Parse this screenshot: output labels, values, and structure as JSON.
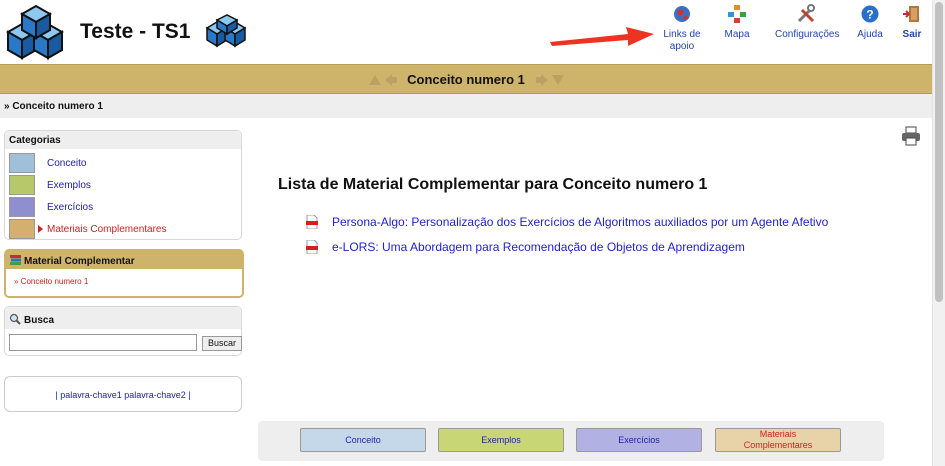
{
  "app": {
    "title": "Teste - TS1"
  },
  "nav": [
    {
      "label": "Links de apoio",
      "icon": "globe-icon"
    },
    {
      "label": "Mapa",
      "icon": "sitemap-icon"
    },
    {
      "label": "Configurações",
      "icon": "tools-icon"
    },
    {
      "label": "Ajuda",
      "icon": "help-icon"
    },
    {
      "label": "Sair",
      "icon": "exit-door-icon"
    }
  ],
  "concept_bar": {
    "title": "Conceito numero 1"
  },
  "breadcrumb": "» Conceito numero 1",
  "sidebar": {
    "categories": {
      "header": "Categorias",
      "items": [
        {
          "label": "Conceito",
          "icon": "book-icon",
          "color": "#9fc0d8"
        },
        {
          "label": "Exemplos",
          "icon": "notebook-icon",
          "color": "#b6c86a"
        },
        {
          "label": "Exercícios",
          "icon": "exercise-icon",
          "color": "#8f8fd0"
        },
        {
          "label": "Materiais Complementares",
          "icon": "books-stack-icon",
          "color": "#d4b070",
          "active": true
        }
      ]
    },
    "material": {
      "header": "Material Complementar",
      "link": "» Conceito numero 1"
    },
    "busca": {
      "header": "Busca",
      "input_value": "",
      "button": "Buscar"
    },
    "keywords": {
      "prefix": "| ",
      "items": [
        "palavra-chave1",
        "palavra-chave2"
      ],
      "suffix": " |"
    }
  },
  "main": {
    "title": "Lista de Material Complementar para Conceito numero 1",
    "materials": [
      "Persona-Algo: Personalização dos Exercícios de Algoritmos auxiliados por um Agente Afetivo",
      "e-LORS: Uma Abordagem para Recomendação de Objetos de Aprendizagem"
    ]
  },
  "bottom_tabs": [
    {
      "label": "Conceito",
      "bg": "#c5d8ea",
      "color": "#2222aa"
    },
    {
      "label": "Exemplos",
      "bg": "#c8d676",
      "color": "#2222aa"
    },
    {
      "label": "Exercícios",
      "bg": "#b1b1e4",
      "color": "#2222aa"
    },
    {
      "label": "Materiais Complementares",
      "bg": "#e8d3a8",
      "color": "#cc2222"
    }
  ],
  "colors": {
    "accent": "#cdb46a",
    "link": "#2222cc",
    "active": "#cc2222"
  }
}
